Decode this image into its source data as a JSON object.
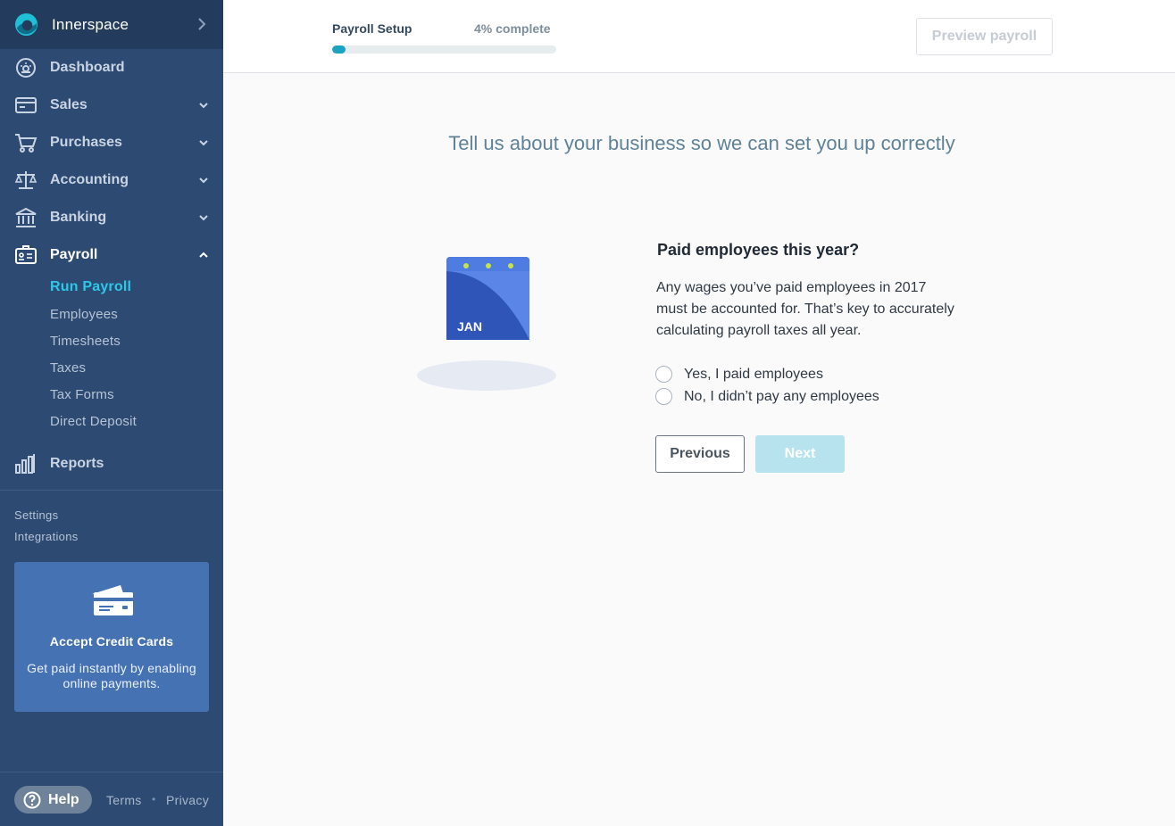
{
  "app": {
    "name": "Innerspace"
  },
  "sidebar": {
    "nav": [
      {
        "label": "Dashboard",
        "icon": "dashboard-icon",
        "has_caret": false
      },
      {
        "label": "Sales",
        "icon": "sales-icon",
        "has_caret": true
      },
      {
        "label": "Purchases",
        "icon": "cart-icon",
        "has_caret": true
      },
      {
        "label": "Accounting",
        "icon": "scales-icon",
        "has_caret": true
      },
      {
        "label": "Banking",
        "icon": "bank-icon",
        "has_caret": true
      },
      {
        "label": "Payroll",
        "icon": "payroll-icon",
        "has_caret": true,
        "expanded": true
      }
    ],
    "payroll_sub": [
      "Run Payroll",
      "Employees",
      "Timesheets",
      "Taxes",
      "Tax Forms",
      "Direct Deposit"
    ],
    "active_sub": "Run Payroll",
    "reports_label": "Reports",
    "settings_label": "Settings",
    "integrations_label": "Integrations",
    "promo": {
      "title": "Accept Credit Cards",
      "body": "Get paid instantly by enabling online payments."
    },
    "footer": {
      "help_label": "Help",
      "terms_label": "Terms",
      "privacy_label": "Privacy"
    }
  },
  "topbar": {
    "setup_title": "Payroll Setup",
    "progress_text": "4% complete",
    "progress_value": 0.06,
    "preview_label": "Preview payroll"
  },
  "main": {
    "headline": "Tell us about your business so we can set you up correctly",
    "illustration_text": "JAN",
    "question_title": "Paid employees this year?",
    "question_desc": "Any wages you’ve paid employees in 2017 must be accounted for. That’s key to accurately calculating payroll taxes all year.",
    "options": [
      "Yes, I paid employees",
      "No, I didn’t pay any employees"
    ],
    "previous_label": "Previous",
    "next_label": "Next"
  },
  "colors": {
    "sidebar_bg": "#2d4a72",
    "accent": "#2cc8e8",
    "progress_fill": "#1ca3c2",
    "next_disabled": "#b6e3ee"
  }
}
